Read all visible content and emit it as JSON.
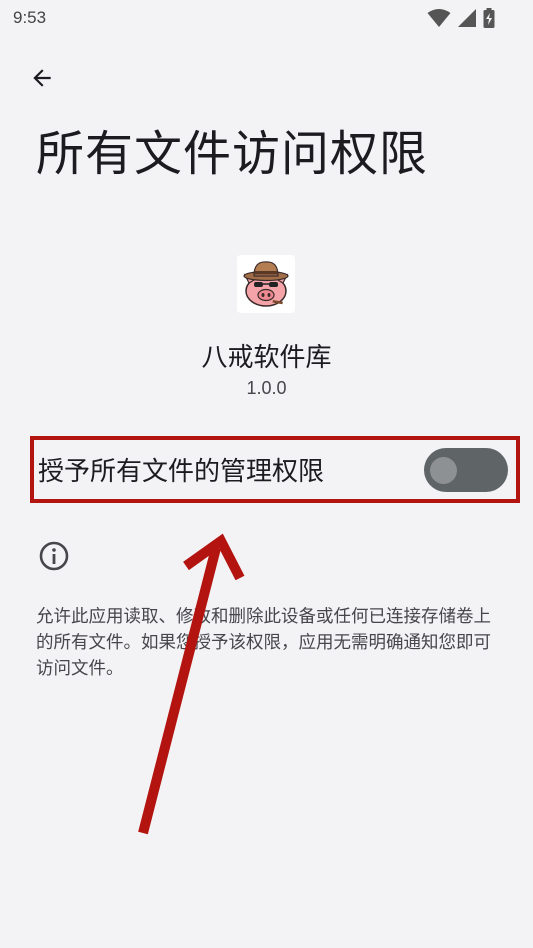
{
  "status_bar": {
    "time": "9:53",
    "icons": [
      "wifi-icon",
      "signal-icon",
      "battery-charging-icon"
    ]
  },
  "header": {
    "back_icon": "arrow-back-icon",
    "title": "所有文件访问权限"
  },
  "app": {
    "icon": "app-logo-pig-cowboy",
    "name": "八戒软件库",
    "version": "1.0.0"
  },
  "permission": {
    "label": "授予所有文件的管理权限",
    "enabled": false
  },
  "info": {
    "icon": "info-icon",
    "description": "允许此应用读取、修改和删除此设备或任何已连接存储卷上的所有文件。如果您授予该权限，应用无需明确通知您即可访问文件。"
  },
  "colors": {
    "background": "#f3f2f5",
    "annotation": "#b3140f",
    "switch_track": "#5f6467",
    "switch_thumb": "#8e9194"
  }
}
